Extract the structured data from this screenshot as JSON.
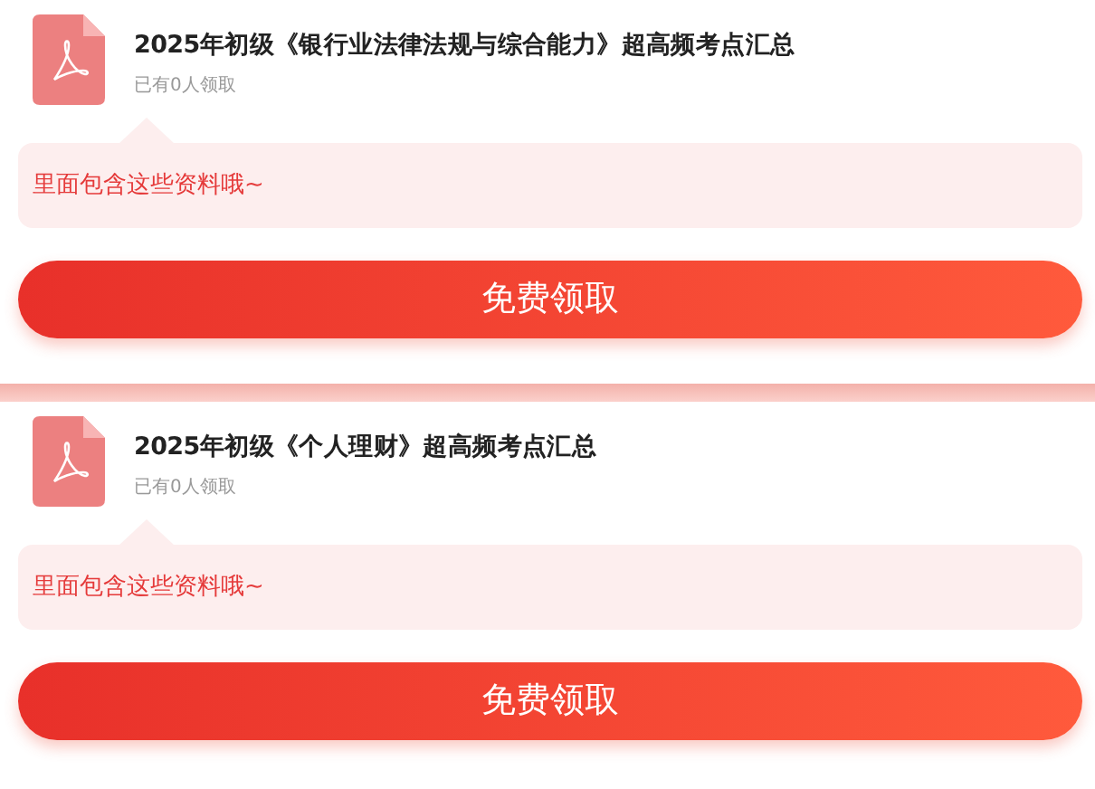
{
  "items": [
    {
      "title": "2025年初级《银行业法律法规与综合能力》超高频考点汇总",
      "claimed": "已有0人领取",
      "note": "里面包含这些资料哦~",
      "button": "免费领取"
    },
    {
      "title": "2025年初级《个人理财》超高频考点汇总",
      "claimed": "已有0人领取",
      "note": "里面包含这些资料哦~",
      "button": "免费领取"
    }
  ]
}
